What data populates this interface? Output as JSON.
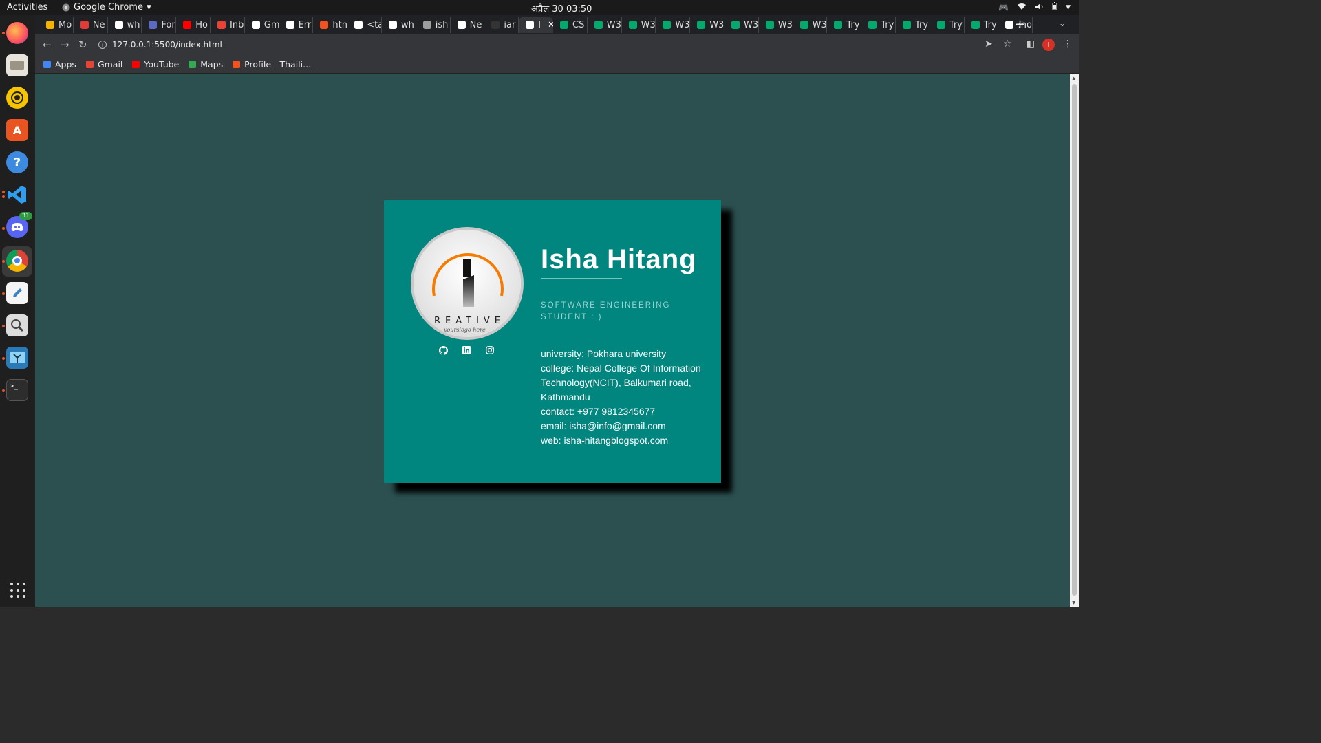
{
  "topbar": {
    "activities": "Activities",
    "app_name": "Google Chrome",
    "clock": "अप्रैल 30  03:50"
  },
  "dock": {
    "apps": [
      "firefox-icon",
      "files-icon",
      "rhythmbox-icon",
      "software-center-icon",
      "help-icon",
      "vscode-icon",
      "discord-icon",
      "chrome-icon",
      "text-editor-icon",
      "screenshot-icon",
      "image-viewer-icon",
      "terminal-icon"
    ],
    "discord_badge": "31"
  },
  "tabs": [
    {
      "label": "Mo",
      "color": "#f4b400"
    },
    {
      "label": "Ne",
      "color": "#e53935"
    },
    {
      "label": "wh",
      "color": "#ffffff"
    },
    {
      "label": "For",
      "color": "#5c6bc0"
    },
    {
      "label": "Ho",
      "color": "#ff0000"
    },
    {
      "label": "Inb",
      "color": "#ea4335"
    },
    {
      "label": "Gm",
      "color": "#ffffff"
    },
    {
      "label": "Err",
      "color": "#ffffff"
    },
    {
      "label": "htn",
      "color": "#f4511e"
    },
    {
      "label": "<ta",
      "color": "#ffffff"
    },
    {
      "label": "wh",
      "color": "#ffffff"
    },
    {
      "label": "ish",
      "color": "#9e9e9e"
    },
    {
      "label": "Ne",
      "color": "#ffffff"
    },
    {
      "label": "iar",
      "color": "#333333"
    },
    {
      "label": "I",
      "color": "#ffffff"
    },
    {
      "label": "CS",
      "color": "#04aa6d"
    },
    {
      "label": "W3",
      "color": "#04aa6d"
    },
    {
      "label": "W3",
      "color": "#04aa6d"
    },
    {
      "label": "W3",
      "color": "#04aa6d"
    },
    {
      "label": "W3",
      "color": "#04aa6d"
    },
    {
      "label": "W3",
      "color": "#04aa6d"
    },
    {
      "label": "W3",
      "color": "#04aa6d"
    },
    {
      "label": "W3",
      "color": "#04aa6d"
    },
    {
      "label": "Try",
      "color": "#04aa6d"
    },
    {
      "label": "Try",
      "color": "#04aa6d"
    },
    {
      "label": "Try",
      "color": "#04aa6d"
    },
    {
      "label": "Try",
      "color": "#04aa6d"
    },
    {
      "label": "Try",
      "color": "#04aa6d"
    },
    {
      "label": ":ho",
      "color": "#ffffff"
    }
  ],
  "active_tab_index": 14,
  "toolbar": {
    "url": "127.0.0.1:5500/index.html",
    "profile_initial": "I"
  },
  "bookmarks": [
    {
      "label": "Apps",
      "color": "#4285f4"
    },
    {
      "label": "Gmail",
      "color": "#ea4335"
    },
    {
      "label": "YouTube",
      "color": "#ff0000"
    },
    {
      "label": "Maps",
      "color": "#34a853"
    },
    {
      "label": "Profile - Thaili...",
      "color": "#f4511e"
    }
  ],
  "card": {
    "name": "Isha Hitang",
    "role": "SOFTWARE ENGINEERING STUDENT : )",
    "logo_text": "REATIVE",
    "logo_tagline": "yourslogo here",
    "info": [
      "university: Pokhara university",
      "college: Nepal College Of Information Technology(NCIT), Balkumari road, Kathmandu",
      "contact: +977 9812345677",
      "email: isha@info@gmail.com",
      "web: isha-hitangblogspot.com"
    ],
    "socials": [
      "github-icon",
      "linkedin-icon",
      "instagram-icon"
    ],
    "colors": {
      "card_bg": "#00857f",
      "page_bg": "#2c5050",
      "accent": "#f57c00"
    }
  }
}
